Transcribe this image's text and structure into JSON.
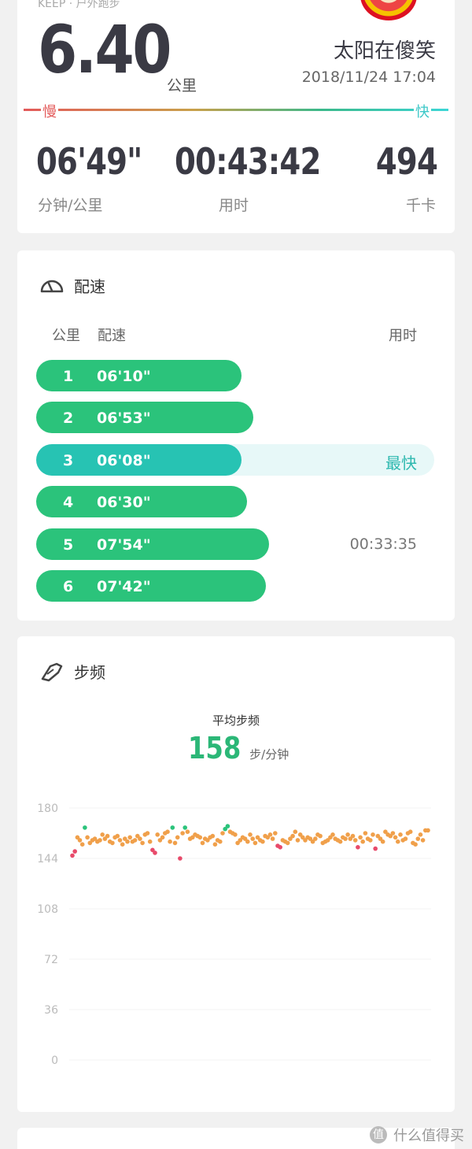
{
  "summary": {
    "source": "KEEP · 户外跑步",
    "distance": "6.40",
    "distance_unit": "公里",
    "username": "太阳在傻笑",
    "datetime": "2018/11/24 17:04",
    "slow_label": "慢",
    "fast_label": "快",
    "stats": [
      {
        "value": "06'49\"",
        "label": "分钟/公里"
      },
      {
        "value": "00:43:42",
        "label": "用时"
      },
      {
        "value": "494",
        "label": "千卡"
      }
    ]
  },
  "pace": {
    "title": "配速",
    "col_km": "公里",
    "col_pace": "配速",
    "col_time": "用时",
    "rows": [
      {
        "km": "1",
        "pace": "06'10\"",
        "fraction": 0.516,
        "tag": "",
        "time": ""
      },
      {
        "km": "2",
        "pace": "06'53\"",
        "fraction": 0.545,
        "tag": "",
        "time": ""
      },
      {
        "km": "3",
        "pace": "06'08\"",
        "fraction": 0.516,
        "tag": "最快",
        "time": ""
      },
      {
        "km": "4",
        "pace": "06'30\"",
        "fraction": 0.53,
        "tag": "",
        "time": ""
      },
      {
        "km": "5",
        "pace": "07'54\"",
        "fraction": 0.585,
        "tag": "",
        "time": "00:33:35"
      },
      {
        "km": "6",
        "pace": "07'42\"",
        "fraction": 0.577,
        "tag": "",
        "time": ""
      }
    ]
  },
  "cadence": {
    "title": "步频",
    "avg_title": "平均步频",
    "avg_value": "158",
    "avg_unit": "步/分钟",
    "chart_data": {
      "type": "scatter",
      "ylim": [
        0,
        180
      ],
      "yticks": [
        "180",
        "144",
        "108",
        "72",
        "36",
        "0"
      ],
      "colors": {
        "normal": "#f0a04b",
        "high": "#2bc37b",
        "low": "#e84a6a"
      },
      "values": [
        146,
        149,
        159,
        157,
        154,
        166,
        159,
        155,
        157,
        158,
        156,
        157,
        161,
        158,
        160,
        156,
        155,
        159,
        160,
        157,
        154,
        158,
        156,
        159,
        156,
        157,
        160,
        158,
        155,
        161,
        162,
        156,
        150,
        148,
        161,
        157,
        159,
        162,
        163,
        156,
        166,
        155,
        159,
        144,
        162,
        166,
        163,
        158,
        159,
        161,
        160,
        159,
        155,
        158,
        157,
        159,
        160,
        154,
        157,
        156,
        162,
        165,
        167,
        163,
        162,
        161,
        155,
        157,
        159,
        158,
        156,
        161,
        158,
        155,
        159,
        157,
        156,
        160,
        159,
        161,
        158,
        162,
        153,
        152,
        157,
        156,
        155,
        158,
        160,
        163,
        157,
        161,
        159,
        157,
        159,
        158,
        156,
        158,
        161,
        160,
        155,
        156,
        157,
        159,
        161,
        158,
        157,
        156,
        159,
        158,
        161,
        158,
        160,
        157,
        152,
        159,
        156,
        162,
        158,
        157,
        161,
        151,
        160,
        158,
        156,
        163,
        161,
        160,
        162,
        159,
        156,
        161,
        157,
        158,
        162,
        163,
        155,
        154,
        158,
        161,
        157,
        164,
        164
      ]
    }
  },
  "watermark": {
    "icon": "值",
    "text": "什么值得买"
  }
}
